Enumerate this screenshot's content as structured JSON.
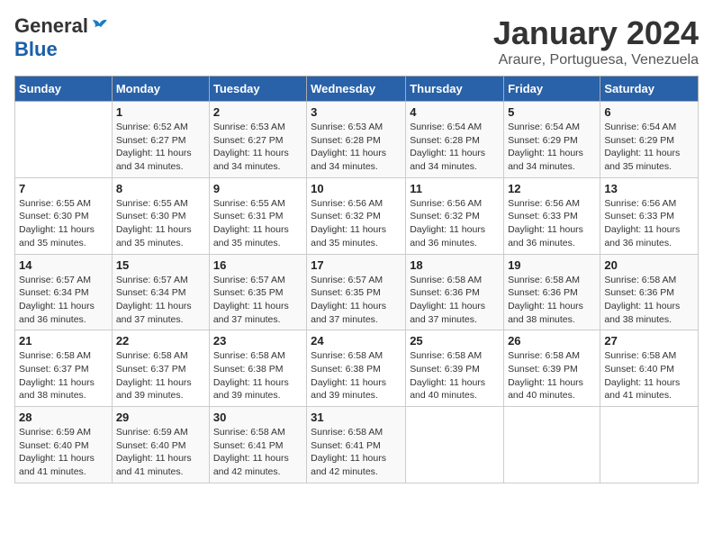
{
  "logo": {
    "general": "General",
    "blue": "Blue"
  },
  "title": "January 2024",
  "subtitle": "Araure, Portuguesa, Venezuela",
  "headers": [
    "Sunday",
    "Monday",
    "Tuesday",
    "Wednesday",
    "Thursday",
    "Friday",
    "Saturday"
  ],
  "weeks": [
    [
      {
        "day": "",
        "info": ""
      },
      {
        "day": "1",
        "info": "Sunrise: 6:52 AM\nSunset: 6:27 PM\nDaylight: 11 hours\nand 34 minutes."
      },
      {
        "day": "2",
        "info": "Sunrise: 6:53 AM\nSunset: 6:27 PM\nDaylight: 11 hours\nand 34 minutes."
      },
      {
        "day": "3",
        "info": "Sunrise: 6:53 AM\nSunset: 6:28 PM\nDaylight: 11 hours\nand 34 minutes."
      },
      {
        "day": "4",
        "info": "Sunrise: 6:54 AM\nSunset: 6:28 PM\nDaylight: 11 hours\nand 34 minutes."
      },
      {
        "day": "5",
        "info": "Sunrise: 6:54 AM\nSunset: 6:29 PM\nDaylight: 11 hours\nand 34 minutes."
      },
      {
        "day": "6",
        "info": "Sunrise: 6:54 AM\nSunset: 6:29 PM\nDaylight: 11 hours\nand 35 minutes."
      }
    ],
    [
      {
        "day": "7",
        "info": "Sunrise: 6:55 AM\nSunset: 6:30 PM\nDaylight: 11 hours\nand 35 minutes."
      },
      {
        "day": "8",
        "info": "Sunrise: 6:55 AM\nSunset: 6:30 PM\nDaylight: 11 hours\nand 35 minutes."
      },
      {
        "day": "9",
        "info": "Sunrise: 6:55 AM\nSunset: 6:31 PM\nDaylight: 11 hours\nand 35 minutes."
      },
      {
        "day": "10",
        "info": "Sunrise: 6:56 AM\nSunset: 6:32 PM\nDaylight: 11 hours\nand 35 minutes."
      },
      {
        "day": "11",
        "info": "Sunrise: 6:56 AM\nSunset: 6:32 PM\nDaylight: 11 hours\nand 36 minutes."
      },
      {
        "day": "12",
        "info": "Sunrise: 6:56 AM\nSunset: 6:33 PM\nDaylight: 11 hours\nand 36 minutes."
      },
      {
        "day": "13",
        "info": "Sunrise: 6:56 AM\nSunset: 6:33 PM\nDaylight: 11 hours\nand 36 minutes."
      }
    ],
    [
      {
        "day": "14",
        "info": "Sunrise: 6:57 AM\nSunset: 6:34 PM\nDaylight: 11 hours\nand 36 minutes."
      },
      {
        "day": "15",
        "info": "Sunrise: 6:57 AM\nSunset: 6:34 PM\nDaylight: 11 hours\nand 37 minutes."
      },
      {
        "day": "16",
        "info": "Sunrise: 6:57 AM\nSunset: 6:35 PM\nDaylight: 11 hours\nand 37 minutes."
      },
      {
        "day": "17",
        "info": "Sunrise: 6:57 AM\nSunset: 6:35 PM\nDaylight: 11 hours\nand 37 minutes."
      },
      {
        "day": "18",
        "info": "Sunrise: 6:58 AM\nSunset: 6:36 PM\nDaylight: 11 hours\nand 37 minutes."
      },
      {
        "day": "19",
        "info": "Sunrise: 6:58 AM\nSunset: 6:36 PM\nDaylight: 11 hours\nand 38 minutes."
      },
      {
        "day": "20",
        "info": "Sunrise: 6:58 AM\nSunset: 6:36 PM\nDaylight: 11 hours\nand 38 minutes."
      }
    ],
    [
      {
        "day": "21",
        "info": "Sunrise: 6:58 AM\nSunset: 6:37 PM\nDaylight: 11 hours\nand 38 minutes."
      },
      {
        "day": "22",
        "info": "Sunrise: 6:58 AM\nSunset: 6:37 PM\nDaylight: 11 hours\nand 39 minutes."
      },
      {
        "day": "23",
        "info": "Sunrise: 6:58 AM\nSunset: 6:38 PM\nDaylight: 11 hours\nand 39 minutes."
      },
      {
        "day": "24",
        "info": "Sunrise: 6:58 AM\nSunset: 6:38 PM\nDaylight: 11 hours\nand 39 minutes."
      },
      {
        "day": "25",
        "info": "Sunrise: 6:58 AM\nSunset: 6:39 PM\nDaylight: 11 hours\nand 40 minutes."
      },
      {
        "day": "26",
        "info": "Sunrise: 6:58 AM\nSunset: 6:39 PM\nDaylight: 11 hours\nand 40 minutes."
      },
      {
        "day": "27",
        "info": "Sunrise: 6:58 AM\nSunset: 6:40 PM\nDaylight: 11 hours\nand 41 minutes."
      }
    ],
    [
      {
        "day": "28",
        "info": "Sunrise: 6:59 AM\nSunset: 6:40 PM\nDaylight: 11 hours\nand 41 minutes."
      },
      {
        "day": "29",
        "info": "Sunrise: 6:59 AM\nSunset: 6:40 PM\nDaylight: 11 hours\nand 41 minutes."
      },
      {
        "day": "30",
        "info": "Sunrise: 6:58 AM\nSunset: 6:41 PM\nDaylight: 11 hours\nand 42 minutes."
      },
      {
        "day": "31",
        "info": "Sunrise: 6:58 AM\nSunset: 6:41 PM\nDaylight: 11 hours\nand 42 minutes."
      },
      {
        "day": "",
        "info": ""
      },
      {
        "day": "",
        "info": ""
      },
      {
        "day": "",
        "info": ""
      }
    ]
  ]
}
